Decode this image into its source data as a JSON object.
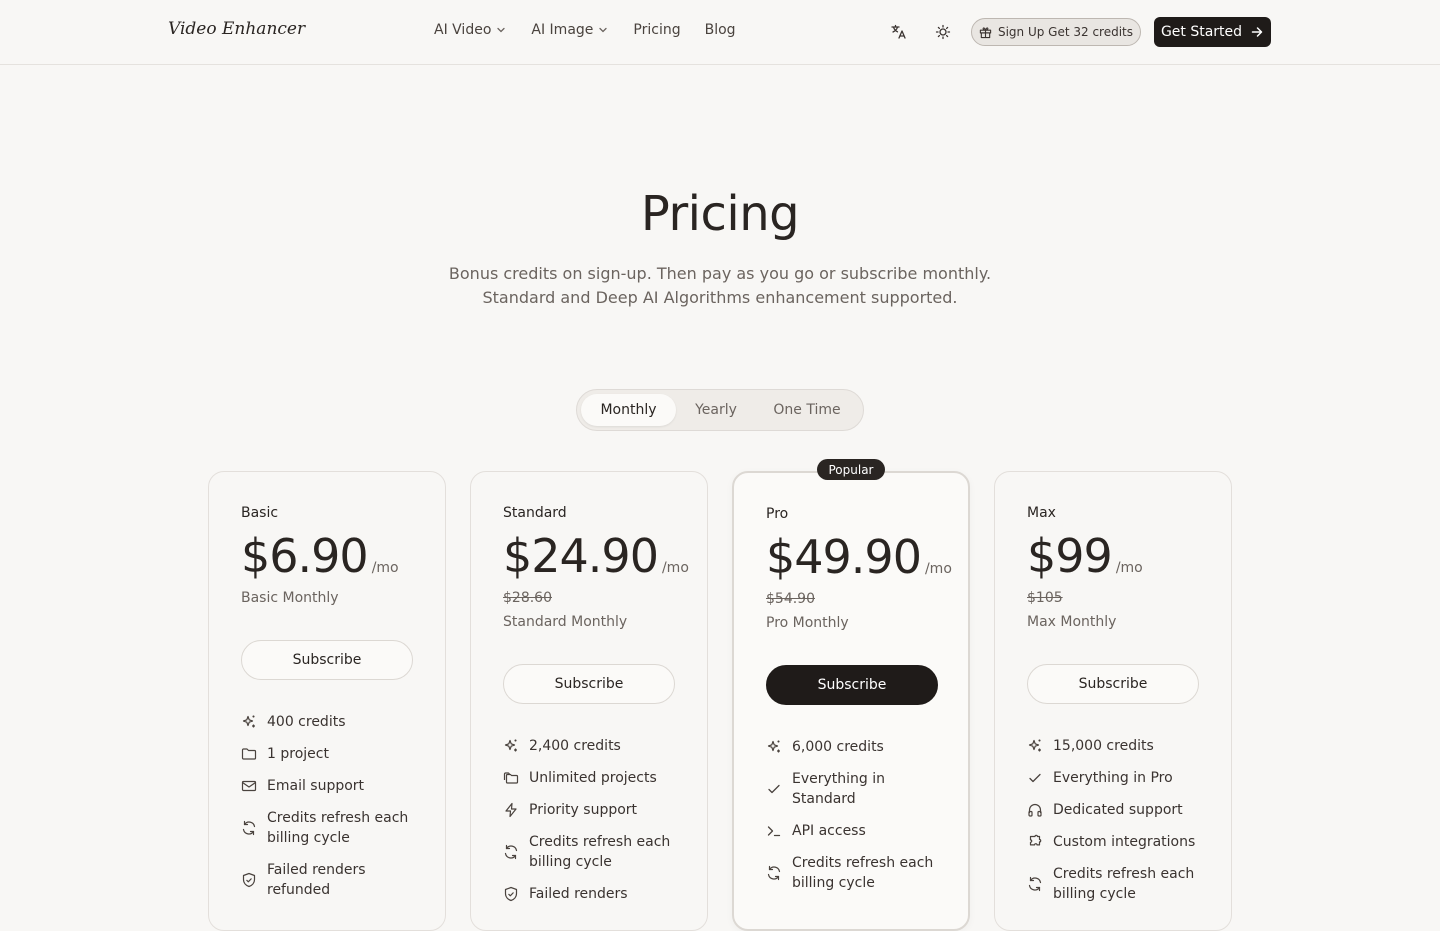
{
  "header": {
    "logo": "Video Enhancer",
    "nav": [
      {
        "label": "AI Video",
        "has_dropdown": true
      },
      {
        "label": "AI Image",
        "has_dropdown": true
      },
      {
        "label": "Pricing",
        "has_dropdown": false
      },
      {
        "label": "Blog",
        "has_dropdown": false
      }
    ],
    "icons": [
      "translate-icon",
      "sun-icon"
    ],
    "signup_pill": "Sign Up Get 32 credits",
    "get_started": "Get Started"
  },
  "hero": {
    "title": "Pricing",
    "subtitle_line1": "Bonus credits on sign-up. Then pay as you go or subscribe monthly.",
    "subtitle_line2": "Standard and Deep AI Algorithms enhancement supported."
  },
  "toggle": {
    "options": [
      "Monthly",
      "Yearly",
      "One Time"
    ],
    "selected": "Monthly"
  },
  "popular_badge": "Popular",
  "plans": [
    {
      "name": "Basic",
      "price": "$6.90",
      "per": "/mo",
      "old_price": "",
      "desc": "Basic Monthly",
      "button": "Subscribe",
      "features": [
        {
          "icon": "sparkle-icon",
          "text": "400 credits"
        },
        {
          "icon": "folder-icon",
          "text": "1 project"
        },
        {
          "icon": "mail-icon",
          "text": "Email support"
        },
        {
          "icon": "refresh-icon",
          "text": "Credits refresh each billing cycle"
        },
        {
          "icon": "shield-check-icon",
          "text": "Failed renders refunded"
        }
      ]
    },
    {
      "name": "Standard",
      "price": "$24.90",
      "per": "/mo",
      "old_price": "$28.60",
      "desc": "Standard Monthly",
      "button": "Subscribe",
      "features": [
        {
          "icon": "sparkle-icon",
          "text": "2,400 credits"
        },
        {
          "icon": "folders-icon",
          "text": "Unlimited projects"
        },
        {
          "icon": "zap-icon",
          "text": "Priority support"
        },
        {
          "icon": "refresh-icon",
          "text": "Credits refresh each billing cycle"
        },
        {
          "icon": "shield-check-icon",
          "text": "Failed renders"
        }
      ]
    },
    {
      "name": "Pro",
      "price": "$49.90",
      "per": "/mo",
      "old_price": "$54.90",
      "desc": "Pro Monthly",
      "button": "Subscribe",
      "features": [
        {
          "icon": "sparkle-icon",
          "text": "6,000 credits"
        },
        {
          "icon": "check-icon",
          "text": "Everything in Standard"
        },
        {
          "icon": "terminal-icon",
          "text": "API access"
        },
        {
          "icon": "refresh-icon",
          "text": "Credits refresh each billing cycle"
        }
      ]
    },
    {
      "name": "Max",
      "price": "$99",
      "per": "/mo",
      "old_price": "$105",
      "desc": "Max Monthly",
      "button": "Subscribe",
      "features": [
        {
          "icon": "sparkle-icon",
          "text": "15,000 credits"
        },
        {
          "icon": "check-icon",
          "text": "Everything in Pro"
        },
        {
          "icon": "headphones-icon",
          "text": "Dedicated support"
        },
        {
          "icon": "puzzle-icon",
          "text": "Custom integrations"
        },
        {
          "icon": "refresh-icon",
          "text": "Credits refresh each billing cycle"
        }
      ]
    }
  ]
}
